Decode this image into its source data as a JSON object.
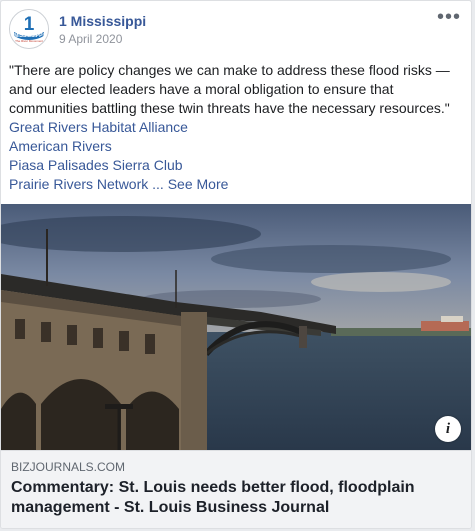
{
  "post": {
    "author": "1 Mississippi",
    "date": "9 April 2020",
    "more_icon": "more-horizontal-icon",
    "quote": "\"There are policy changes we can make to address these flood risks — and our elected leaders have a moral obligation to ensure that communities battling these twin threats have the necessary resources.\"",
    "tags": [
      "Great Rivers Habitat Alliance",
      "American Rivers",
      "Piasa Palisades Sierra Club"
    ],
    "last_tag": "Prairie Rivers Network",
    "see_more": "... See More"
  },
  "avatar": {
    "logo_text": "1",
    "logo_word": "MISSISSIPPI",
    "logo_sub": "The River Movement"
  },
  "link_preview": {
    "domain": "bizjournals.com",
    "title": "Commentary: St. Louis needs better flood, floodplain management - St. Louis Business Journal",
    "info_glyph": "i"
  },
  "colors": {
    "link": "#385898",
    "text": "#1c1e21",
    "muted": "#90949c"
  }
}
